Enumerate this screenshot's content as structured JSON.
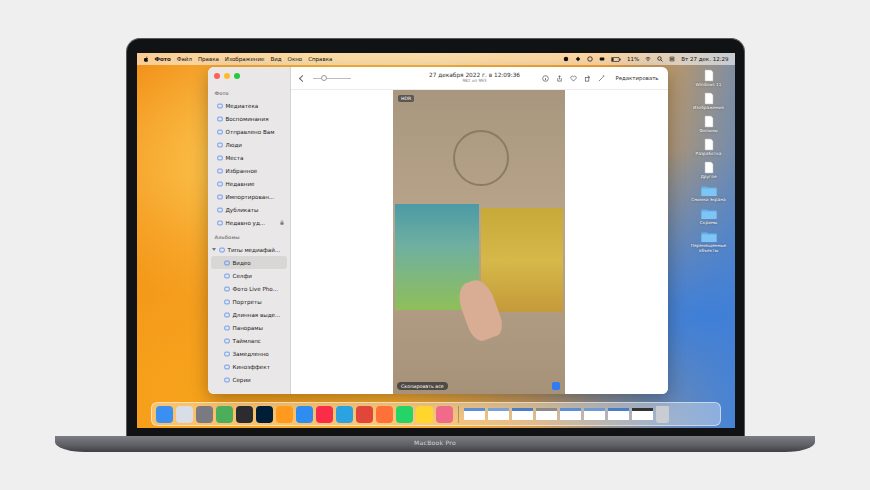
{
  "device": {
    "label": "MacBook Pro"
  },
  "menu_bar": {
    "items": [
      {
        "label": "Фото",
        "bold": true
      },
      {
        "label": "Файл",
        "bold": false
      },
      {
        "label": "Правка",
        "bold": false
      },
      {
        "label": "Изображение",
        "bold": false
      },
      {
        "label": "Вид",
        "bold": false
      },
      {
        "label": "Окно",
        "bold": false
      },
      {
        "label": "Справка",
        "bold": false
      }
    ],
    "battery": "11%",
    "clock": "Вт 27 дек. 12:29"
  },
  "window": {
    "title": "27 декабря 2022 г. в 12:09:36",
    "subtitle": "982 из 993",
    "edit_button": "Редактировать",
    "sidebar": {
      "sections": [
        {
          "label": "Фото",
          "items": [
            {
              "label": "Медиатека",
              "selected": false,
              "locked": false
            },
            {
              "label": "Воспоминания",
              "selected": false,
              "locked": false
            },
            {
              "label": "Отправлено Вам",
              "selected": false,
              "locked": false
            },
            {
              "label": "Люди",
              "selected": false,
              "locked": false
            },
            {
              "label": "Места",
              "selected": false,
              "locked": false
            },
            {
              "label": "Избранное",
              "selected": false,
              "locked": false
            },
            {
              "label": "Недавние",
              "selected": false,
              "locked": false
            },
            {
              "label": "Импортирован...",
              "selected": false,
              "locked": false
            },
            {
              "label": "Дубликаты",
              "selected": false,
              "locked": false
            },
            {
              "label": "Недавно уд...",
              "selected": false,
              "locked": true
            }
          ]
        },
        {
          "label": "Альбомы",
          "items": [
            {
              "label": "Типы медиафай...",
              "selected": false,
              "locked": false,
              "expanded": true,
              "children": [
                {
                  "label": "Видео",
                  "selected": true
                },
                {
                  "label": "Селфи",
                  "selected": false
                },
                {
                  "label": "Фото Live Pho...",
                  "selected": false
                },
                {
                  "label": "Портреты",
                  "selected": false
                },
                {
                  "label": "Длинная выде...",
                  "selected": false
                },
                {
                  "label": "Панорамы",
                  "selected": false
                },
                {
                  "label": "Таймлапс",
                  "selected": false
                },
                {
                  "label": "Замедленно",
                  "selected": false
                },
                {
                  "label": "Киноэффект",
                  "selected": false
                },
                {
                  "label": "Серии",
                  "selected": false
                }
              ]
            }
          ]
        }
      ]
    },
    "photo": {
      "badge": "HDR",
      "live_text_button": "Скопировать все"
    }
  },
  "desktop_icons": [
    {
      "label": "Windows 11",
      "kind": "file"
    },
    {
      "label": "Изображения",
      "kind": "file"
    },
    {
      "label": "Фильмы",
      "kind": "file"
    },
    {
      "label": "Разработка",
      "kind": "file"
    },
    {
      "label": "Другое",
      "kind": "file"
    },
    {
      "label": "Снимки экрана",
      "kind": "folder"
    },
    {
      "label": "Скрины",
      "kind": "folder"
    },
    {
      "label": "Перемещенные объекты",
      "kind": "folder"
    }
  ],
  "dock": [
    {
      "kind": "app",
      "color": "#3b8ff0"
    },
    {
      "kind": "app",
      "color": "#d9dde6"
    },
    {
      "kind": "app",
      "color": "#7a7a80"
    },
    {
      "kind": "app",
      "color": "#4cae5a"
    },
    {
      "kind": "app",
      "color": "#2b2b30"
    },
    {
      "kind": "app",
      "color": "#001e36"
    },
    {
      "kind": "app",
      "color": "#ff9a1f"
    },
    {
      "kind": "app",
      "color": "#2f8cf0"
    },
    {
      "kind": "app",
      "color": "#fa2d48"
    },
    {
      "kind": "app",
      "color": "#2aa3e0"
    },
    {
      "kind": "app",
      "color": "#e0463a"
    },
    {
      "kind": "app",
      "color": "#ff7139"
    },
    {
      "kind": "app",
      "color": "#25d366"
    },
    {
      "kind": "app",
      "color": "#ffd52e"
    },
    {
      "kind": "app",
      "color": "#f06a8a"
    },
    {
      "kind": "window",
      "color": "#5a8fd8"
    },
    {
      "kind": "window",
      "color": "#7aa2d6"
    },
    {
      "kind": "window",
      "color": "#4c7cc4"
    },
    {
      "kind": "window",
      "color": "#8a8a8a"
    },
    {
      "kind": "window",
      "color": "#5a8fd8"
    },
    {
      "kind": "window",
      "color": "#6f9bd2"
    },
    {
      "kind": "window",
      "color": "#4c7cc4"
    },
    {
      "kind": "window",
      "color": "#333333"
    },
    {
      "kind": "trash",
      "color": "#c9ccd2"
    }
  ]
}
